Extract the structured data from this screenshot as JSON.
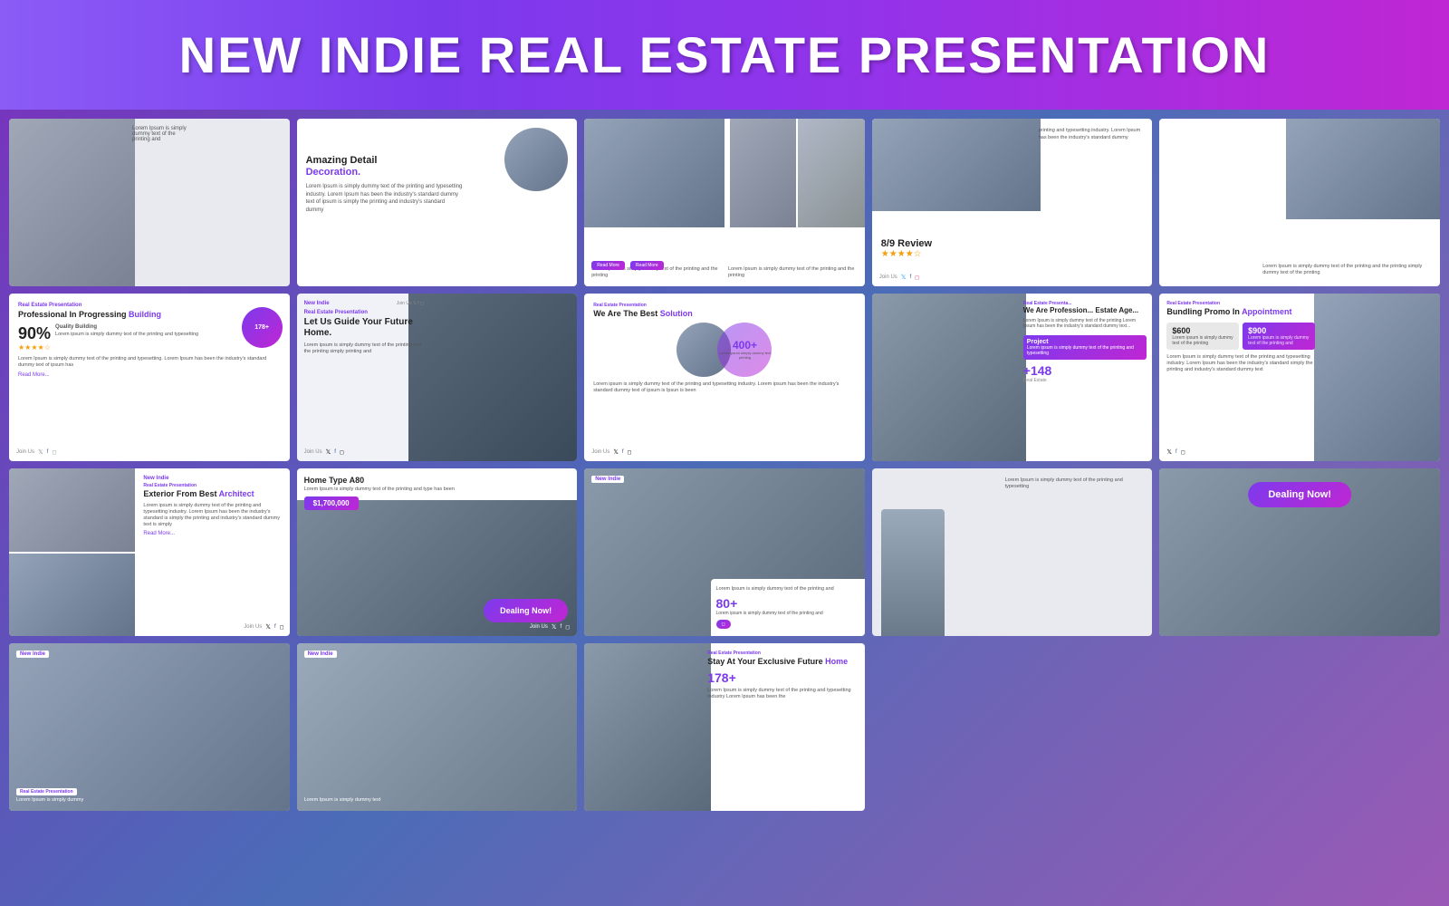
{
  "header": {
    "title": "NEW INDIE REAL ESTATE PRESENTATION"
  },
  "slides": {
    "row1": [
      {
        "id": "r1s1",
        "type": "image-text",
        "brand": "",
        "title": "",
        "subtitle": "Lorem Ipsum is simply dummy text of the printing and typesetting"
      },
      {
        "id": "r1s2",
        "type": "decoration",
        "brand": "",
        "title": "Amazing Detail Decoration.",
        "subtitle": "Lorem Ipsum is simply dummy text of the printing and typesetting industry. Lorem Ipsum has been the industry's standard dummy text of ipsum is simply the printing and industry's standard dummy"
      },
      {
        "id": "r1s3",
        "type": "two-col",
        "brand": "",
        "title": "",
        "col1": "Lorem Ipsum is simply dummy text of the printing and the printing",
        "col2": "Lorem Ipsum is simply dummy text of the printing and the printing",
        "btn1": "Read More",
        "btn2": "Read More"
      },
      {
        "id": "r1s4",
        "type": "review",
        "brand": "",
        "title": "8/9 Review",
        "stars": "★★★★☆",
        "subtitle": "printing and typesetting industry. Lorem Ipsum has been the industry's standard dummy",
        "join": "Join Us"
      },
      {
        "id": "r1s5",
        "type": "text-only",
        "brand": "",
        "title": "",
        "subtitle": "Lorem Ipsum is simply dummy text of the printing and the printing simply dummy text of the printing"
      }
    ],
    "row2": [
      {
        "id": "r2s1",
        "type": "building-stats",
        "brand": "Real Estate Presentation",
        "title": "Professional In Progressing Building",
        "accentWord": "Building",
        "stat1": "178+",
        "stat2": "90%",
        "stat2Label": "Quality Building",
        "stars": "★★★★☆",
        "subtitle": "Lorem Ipsum is simply dummy text of the printing and typesetting. Lorem Ipsum has been the industry's standard dummy text of ipsum has",
        "readMore": "Read More..."
      },
      {
        "id": "r2s2",
        "type": "hero",
        "brand": "New Indie",
        "subBrand": "Real Estate Presentation",
        "title": "Let Us Guide Your Future Home.",
        "subtitle": "Lorem ipsum is simply dummy text of the printing and the printing simply printing and",
        "join": "Join Us"
      },
      {
        "id": "r2s3",
        "type": "solution",
        "brand": "Real Estate Presentation",
        "title": "We Are The Best Solution",
        "stat": "400+",
        "statLabel": "Lorem ipsum is simply dummy text of the printing and typesetting",
        "subtitle": "Lorem ipsum is simply dummy text of the printing and typesetting industry. Lorem ipsum has been the industry's standard dummy text of ipsum is Ipsun is been",
        "join": "Join Us"
      },
      {
        "id": "r2s4",
        "type": "team",
        "brand": "Real Estate Presentation",
        "title": "We Are Professional Estate Age",
        "subtitle": "Lorem Ipsum is simply dummy text of the printing Lorem Ipsum has been the industry's standard dummy text of ipsum is simply",
        "project": "Project",
        "projectDesc": "Lorem Ipsum is simply dummy text of the printing and typesetting",
        "stat": "+148",
        "statLabel": "Deal Estate"
      }
    ],
    "row3": [
      {
        "id": "r3s1",
        "type": "bundling",
        "brand": "Real Estate Presentation",
        "title": "Bundling Promo In Appointment",
        "accentWord": "Appointment",
        "price1": "$600",
        "price1Desc": "Lorem ipsum is simply dummy text of the printing",
        "price2": "$900",
        "price2Desc": "Lorem ipsum is simply dummy text of the printing and",
        "subtitle": "Lorem Ipsum is simply dummy text of the printing and typesetting industry. Lorem Ipsum has been the industry's standard simply the printing and industry's standard dummy text"
      },
      {
        "id": "r3s2",
        "type": "architect",
        "brand": "New Indie",
        "subBrand": "Real Estate Presentation",
        "title": "Exterior From Best Architect",
        "accentWord": "Architect",
        "subtitle": "Lorem ipsum is simply dummy text of the printing and typesetting industry. Lorem Ipsum has been the industry's standard is simply the printing and industry's standard dummy text is simply",
        "readMore": "Read More...",
        "join": "Join Us"
      },
      {
        "id": "r3s3",
        "type": "home-type",
        "title": "Home Type A80",
        "subtitle": "Lorem Ipsum is simply dummy text of the printing and type has been",
        "price": "$1,700,000",
        "dealingBadge": "Dealing Now!",
        "join": "Join Us"
      },
      {
        "id": "r3s4",
        "type": "interior",
        "brand": "New Indie",
        "subtitle": "Lorem Ipsum is simply dummy text of the printing and",
        "stat": "80+",
        "statDesc": "Lorem ipsum is simply dummy text of the printing and"
      }
    ],
    "row4": [
      {
        "id": "r4s1",
        "type": "person",
        "subtitle": "Lorem Ipsum is simply dummy text of the printing and typesetting"
      },
      {
        "id": "r4s2",
        "type": "dealing",
        "dealingBadge": "Dealing Now!",
        "subtitle": ""
      },
      {
        "id": "r4s3",
        "type": "keys",
        "brand": "New Indie",
        "subBrand": "Real Estate Presentation",
        "subtitle": "Lorem Ipsum is simply dummy"
      },
      {
        "id": "r4s4",
        "type": "laptop",
        "brand": "New Indie",
        "subtitle": "Lorem Ipsum is simply dummy text"
      },
      {
        "id": "r4s5",
        "type": "future-home",
        "brand": "Real Estate Presentation",
        "title": "Stay At Your Exclusive Future Home",
        "accentWord": "Home",
        "stat": "178+",
        "subtitle": "Lorem Ipsum is simply dummy text of the printing and typesetting industry Lorem Ipsum has been the"
      }
    ]
  }
}
